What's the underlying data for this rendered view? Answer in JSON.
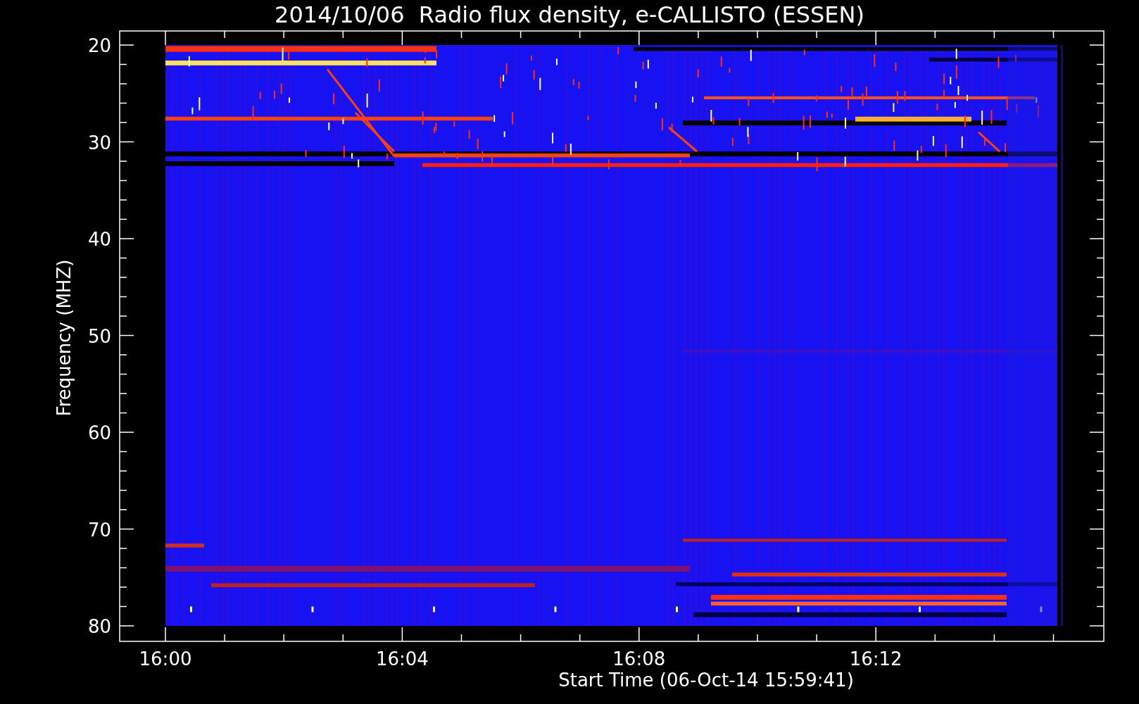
{
  "title": "2014/10/06  Radio flux density, e-CALLISTO (ESSEN)",
  "y_axis": {
    "label": "Frequency (MHZ)",
    "ticks": [
      "20",
      "30",
      "40",
      "50",
      "60",
      "70",
      "80"
    ]
  },
  "x_axis": {
    "label": "Start Time (06-Oct-14 15:59:41)",
    "ticks": [
      "16:00",
      "16:04",
      "16:08",
      "16:12"
    ]
  }
}
